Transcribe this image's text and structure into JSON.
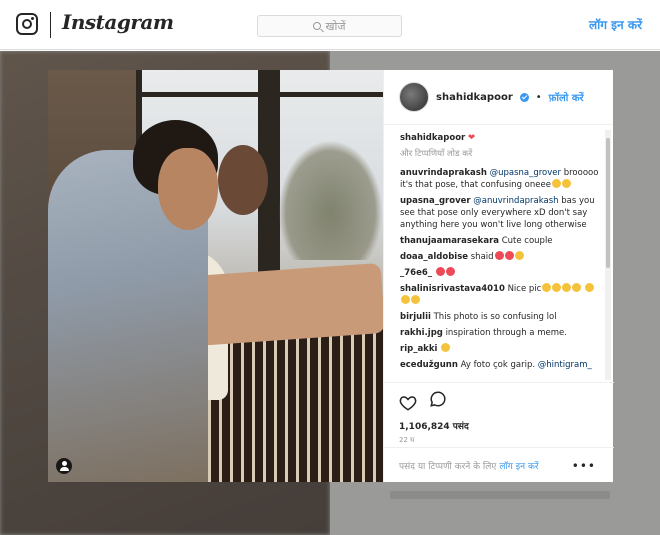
{
  "nav": {
    "brand": "Instagram",
    "search_placeholder": "खोजें",
    "login": "लॉग इन करें"
  },
  "post": {
    "username": "shahidkapoor",
    "separator": "•",
    "follow": "फ़ॉलो करें",
    "caption_user": "shahidkapoor",
    "caption_heart": "❤",
    "load_more": "और टिप्पणियाँ लोड करें",
    "comments": [
      {
        "user": "anuvrindaprakash",
        "mention": "@upasna_grover",
        "text": "brooooo it's that pose, that confusing oneee"
      },
      {
        "user": "upasna_grover",
        "mention": "@anuvrindaprakash",
        "text": "bas you see that pose only everywhere xD don't say anything here you won't live long otherwise"
      },
      {
        "user": "thanujaamarasekara",
        "mention": "",
        "text": "Cute couple"
      },
      {
        "user": "doaa_aldobise",
        "mention": "",
        "text": "shaid"
      },
      {
        "user": "_76e6_",
        "mention": "",
        "text": ""
      },
      {
        "user": "shalinisrivastava4010",
        "mention": "",
        "text": "Nice pic"
      },
      {
        "user": "birjulii",
        "mention": "",
        "text": "This photo is so confusing lol"
      },
      {
        "user": "rakhi.jpg",
        "mention": "",
        "text": "inspiration through a meme."
      },
      {
        "user": "rip_akki",
        "mention": "",
        "text": ""
      },
      {
        "user": "ecedužgunn",
        "mention": "",
        "text": "Ay foto çok garip."
      },
      {
        "user": "",
        "mention": "@hintigram_",
        "text": ""
      }
    ],
    "likes": "1,106,824 पसंद",
    "time": "22 घ",
    "add_comment_prefix": "पसंद या टिप्पणी करने के लिए",
    "add_comment_login": "लॉग इन करें",
    "more": "•••"
  },
  "colors": {
    "accent": "#3897f0",
    "heart": "#ed4956",
    "text": "#262626",
    "muted": "#999999"
  }
}
